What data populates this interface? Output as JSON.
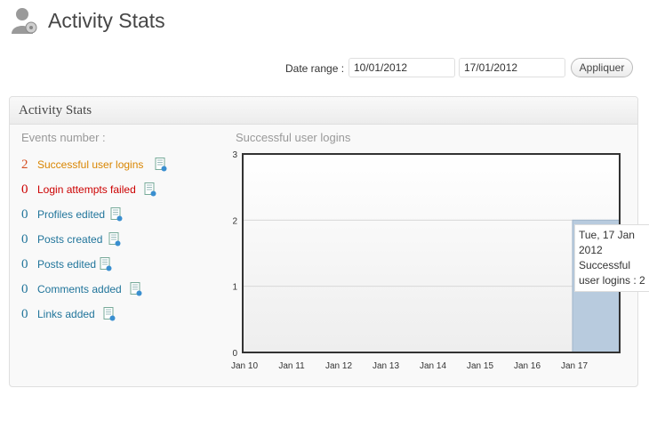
{
  "page": {
    "title": "Activity Stats",
    "icon": "users-icon"
  },
  "date_range": {
    "label": "Date range :",
    "from": "10/01/2012",
    "to": "17/01/2012",
    "apply_label": "Appliquer"
  },
  "panel": {
    "title": "Activity Stats",
    "events_header": "Events number :",
    "events": [
      {
        "count": "2",
        "label": "Successful user logins",
        "color": "#d98500",
        "icon": "report-icon"
      },
      {
        "count": "0",
        "label": "Login attempts failed",
        "color": "#cc0000",
        "icon": "report-icon"
      },
      {
        "count": "0",
        "label": "Profiles edited",
        "color": "#21759b",
        "icon": "report-icon"
      },
      {
        "count": "0",
        "label": "Posts created",
        "color": "#21759b",
        "icon": "report-icon"
      },
      {
        "count": "0",
        "label": "Posts edited",
        "color": "#21759b",
        "icon": "report-icon"
      },
      {
        "count": "0",
        "label": "Comments added",
        "color": "#21759b",
        "icon": "report-icon"
      },
      {
        "count": "0",
        "label": "Links added",
        "color": "#21759b",
        "icon": "report-icon"
      }
    ]
  },
  "chart_data": {
    "type": "bar",
    "title": "Successful user logins",
    "categories": [
      "Jan 10",
      "Jan 11",
      "Jan 12",
      "Jan 13",
      "Jan 14",
      "Jan 15",
      "Jan 16",
      "Jan 17"
    ],
    "values": [
      0,
      0,
      0,
      0,
      0,
      0,
      0,
      2
    ],
    "ylim": [
      0,
      3
    ],
    "yticks": [
      "0",
      "1",
      "2",
      "3"
    ],
    "grid": true,
    "bar_color": "#b8cbde",
    "tooltip": {
      "line1": "Tue, 17 Jan",
      "line2": "2012",
      "line3": "Successful",
      "line4": "user logins : 2"
    }
  }
}
